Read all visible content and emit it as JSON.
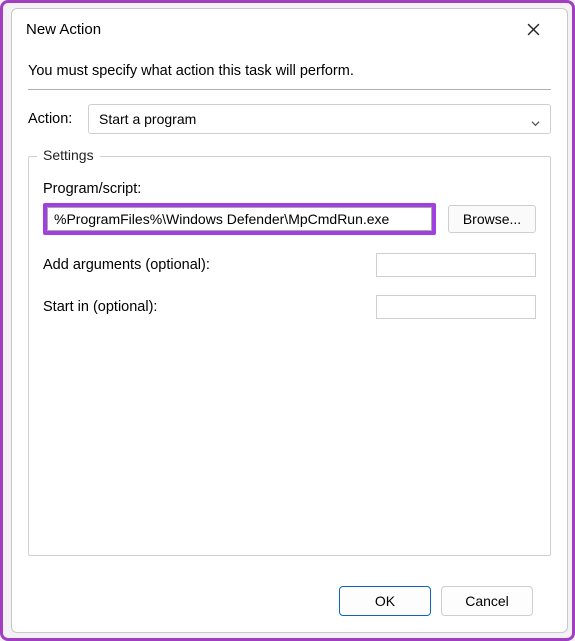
{
  "titlebar": {
    "title": "New Action"
  },
  "instruction": "You must specify what action this task will perform.",
  "action": {
    "label": "Action:",
    "selected": "Start a program"
  },
  "settings": {
    "legend": "Settings",
    "program_label": "Program/script:",
    "program_value": "%ProgramFiles%\\Windows Defender\\MpCmdRun.exe",
    "browse_label": "Browse...",
    "arguments_label": "Add arguments (optional):",
    "arguments_value": "",
    "startin_label": "Start in (optional):",
    "startin_value": ""
  },
  "footer": {
    "ok": "OK",
    "cancel": "Cancel"
  }
}
